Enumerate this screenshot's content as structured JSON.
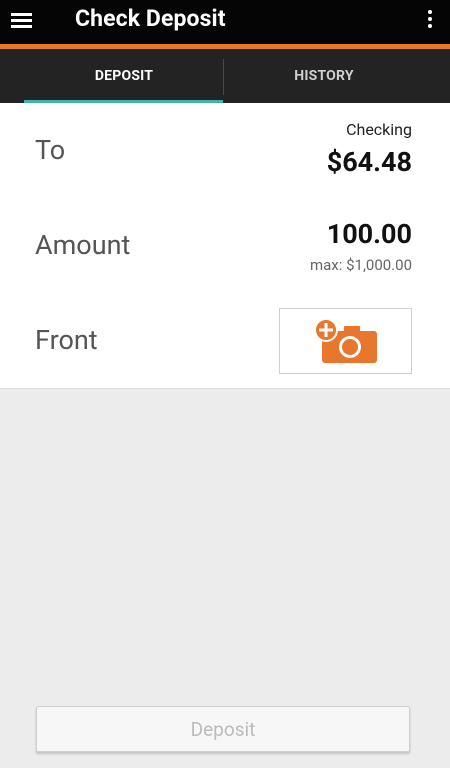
{
  "app_bar": {
    "title": "Check Deposit",
    "menu_icon": "hamburger-menu-icon",
    "overflow_icon": "more-vertical-icon"
  },
  "tabs": [
    {
      "label": "DEPOSIT",
      "selected": true
    },
    {
      "label": "HISTORY",
      "selected": false
    }
  ],
  "form": {
    "to": {
      "label": "To",
      "account_name": "Checking",
      "balance": "$64.48"
    },
    "amount": {
      "label": "Amount",
      "value": "100.00",
      "limit": "max: $1,000.00"
    },
    "front": {
      "label": "Front",
      "icon": "add-photo-camera-icon"
    }
  },
  "deposit_button": {
    "label": "Deposit",
    "enabled": false
  },
  "colors": {
    "accent_orange": "#e8762c",
    "tab_indicator": "#3fb3a8",
    "app_bar_bg": "#050505",
    "tab_bar_bg": "#232323"
  }
}
